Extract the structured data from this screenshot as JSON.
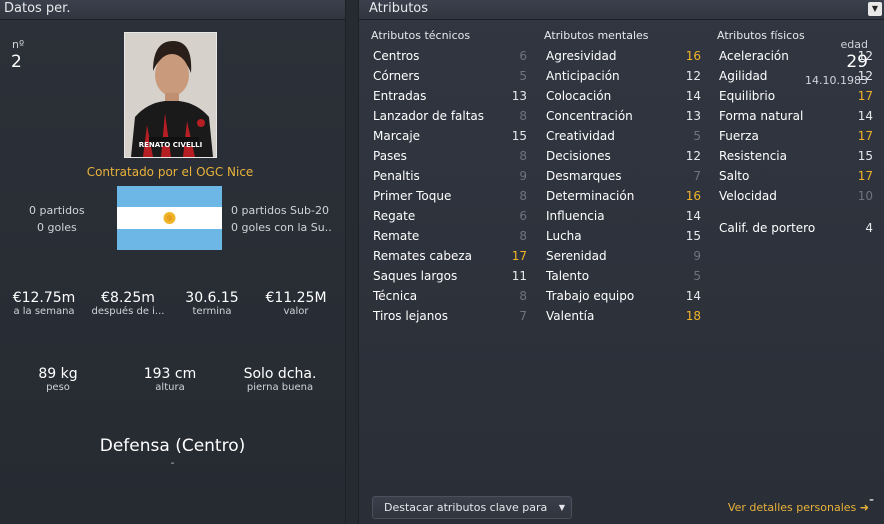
{
  "left_panel": {
    "title": "Datos per.",
    "number_label": "nº",
    "number": "2",
    "age_label": "edad",
    "age": "29",
    "dob": "14.10.1983",
    "photo_caption": "RENATO CIVELLI",
    "contract": "Contratado por el OGC Nice",
    "apps_left": "0 partidos",
    "goals_left": "0 goles",
    "apps_right": "0 partidos Sub-20",
    "goals_right": "0 goles con la Su...",
    "wage": "€12.75m",
    "wage_label": "a la semana",
    "net": "€8.25m",
    "net_label": "después de i...",
    "expires": "30.6.15",
    "expires_label": "termina",
    "value": "€11.25M",
    "value_label": "valor",
    "weight": "89 kg",
    "weight_label": "peso",
    "height": "193 cm",
    "height_label": "altura",
    "foot": "Solo dcha.",
    "foot_label": "pierna buena",
    "position": "Defensa (Centro)",
    "position_sub": "-",
    "more_link": "Ver detalles personales ➜",
    "club_badge_colors": [
      "#ffffff",
      "#6fb8dc"
    ],
    "flag_colors": {
      "blue": "#6cb7e6",
      "white": "#ffffff",
      "sun": "#f0b428"
    }
  },
  "right_panel": {
    "title": "Atributos",
    "technical_header": "Atributos técnicos",
    "mental_header": "Atributos mentales",
    "physical_header": "Atributos físicos",
    "technical": [
      {
        "name": "Centros",
        "value": "6",
        "tone": "g"
      },
      {
        "name": "Córners",
        "value": "5",
        "tone": "g"
      },
      {
        "name": "Entradas",
        "value": "13",
        "tone": "w"
      },
      {
        "name": "Lanzador de faltas",
        "value": "8",
        "tone": "g"
      },
      {
        "name": "Marcaje",
        "value": "15",
        "tone": "w"
      },
      {
        "name": "Pases",
        "value": "8",
        "tone": "g"
      },
      {
        "name": "Penaltis",
        "value": "9",
        "tone": "g"
      },
      {
        "name": "Primer Toque",
        "value": "8",
        "tone": "g"
      },
      {
        "name": "Regate",
        "value": "6",
        "tone": "g"
      },
      {
        "name": "Remate",
        "value": "8",
        "tone": "g"
      },
      {
        "name": "Remates cabeza",
        "value": "17",
        "tone": "o"
      },
      {
        "name": "Saques largos",
        "value": "11",
        "tone": "w"
      },
      {
        "name": "Técnica",
        "value": "8",
        "tone": "g"
      },
      {
        "name": "Tiros lejanos",
        "value": "7",
        "tone": "g"
      }
    ],
    "mental": [
      {
        "name": "Agresividad",
        "value": "16",
        "tone": "o"
      },
      {
        "name": "Anticipación",
        "value": "12",
        "tone": "w"
      },
      {
        "name": "Colocación",
        "value": "14",
        "tone": "w"
      },
      {
        "name": "Concentración",
        "value": "13",
        "tone": "w"
      },
      {
        "name": "Creatividad",
        "value": "5",
        "tone": "g"
      },
      {
        "name": "Decisiones",
        "value": "12",
        "tone": "w"
      },
      {
        "name": "Desmarques",
        "value": "7",
        "tone": "g"
      },
      {
        "name": "Determinación",
        "value": "16",
        "tone": "o"
      },
      {
        "name": "Influencia",
        "value": "14",
        "tone": "w"
      },
      {
        "name": "Lucha",
        "value": "15",
        "tone": "w"
      },
      {
        "name": "Serenidad",
        "value": "9",
        "tone": "g"
      },
      {
        "name": "Talento",
        "value": "5",
        "tone": "g"
      },
      {
        "name": "Trabajo equipo",
        "value": "14",
        "tone": "w"
      },
      {
        "name": "Valentía",
        "value": "18",
        "tone": "o"
      }
    ],
    "physical": [
      {
        "name": "Aceleración",
        "value": "12",
        "tone": "w"
      },
      {
        "name": "Agilidad",
        "value": "12",
        "tone": "w"
      },
      {
        "name": "Equilibrio",
        "value": "17",
        "tone": "o"
      },
      {
        "name": "Forma natural",
        "value": "14",
        "tone": "w"
      },
      {
        "name": "Fuerza",
        "value": "17",
        "tone": "o"
      },
      {
        "name": "Resistencia",
        "value": "15",
        "tone": "w"
      },
      {
        "name": "Salto",
        "value": "17",
        "tone": "o"
      },
      {
        "name": "Velocidad",
        "value": "10",
        "tone": "g"
      }
    ],
    "goalkeeper_label": "Calif. de portero",
    "goalkeeper_value": "4",
    "highlight_dropdown": "Destacar atributos clave para el...",
    "minus_label": "-"
  }
}
